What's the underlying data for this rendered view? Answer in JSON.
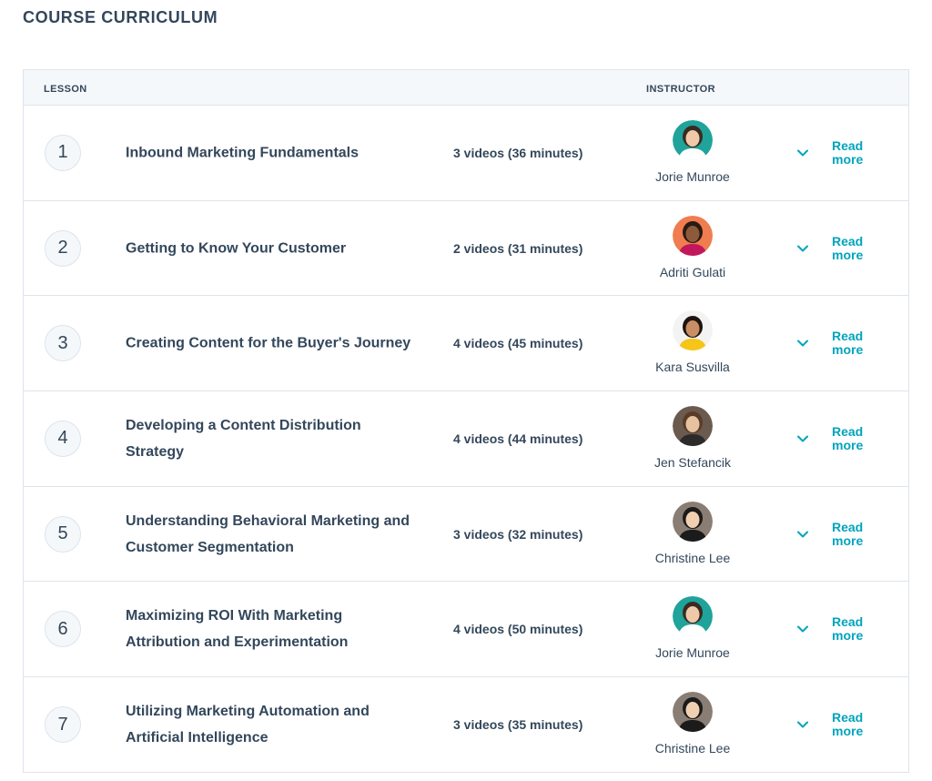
{
  "page": {
    "title": "COURSE CURRICULUM"
  },
  "table": {
    "headers": {
      "lesson": "LESSON",
      "instructor": "INSTRUCTOR"
    },
    "rows": [
      {
        "number": "1",
        "title": "Inbound Marketing Fundamentals",
        "duration": "3 videos (36 minutes)",
        "instructor": "Jorie Munroe",
        "action": "Read more"
      },
      {
        "number": "2",
        "title": "Getting to Know Your Customer",
        "duration": "2 videos (31 minutes)",
        "instructor": "Adriti Gulati",
        "action": "Read more"
      },
      {
        "number": "3",
        "title": "Creating Content for the Buyer's Journey",
        "duration": "4 videos (45 minutes)",
        "instructor": "Kara Susvilla",
        "action": "Read more"
      },
      {
        "number": "4",
        "title": "Developing a Content Distribution Strategy",
        "duration": "4 videos (44 minutes)",
        "instructor": "Jen Stefancik",
        "action": "Read more"
      },
      {
        "number": "5",
        "title": "Understanding Behavioral Marketing and Customer Segmentation",
        "duration": "3 videos (32 minutes)",
        "instructor": "Christine Lee",
        "action": "Read more"
      },
      {
        "number": "6",
        "title": "Maximizing ROI With Marketing Attribution and Experimentation",
        "duration": "4 videos (50 minutes)",
        "instructor": "Jorie Munroe",
        "action": "Read more"
      },
      {
        "number": "7",
        "title": "Utilizing Marketing Automation and Artificial Intelligence",
        "duration": "3 videos (35 minutes)",
        "instructor": "Christine Lee",
        "action": "Read more"
      }
    ]
  },
  "icons": {
    "expand": "chevron-down-icon",
    "avatar": "avatar-icon"
  },
  "colors": {
    "text": "#33475b",
    "accent": "#00a4bd",
    "border": "#dfe3eb",
    "header_bg": "#f5f8fa",
    "avatar_bgs": [
      "#1fa39a",
      "#ef7d4f",
      "#f3f3f3",
      "#6b5a4e",
      "#8a7d73",
      "#1fa39a",
      "#8a7d73"
    ],
    "avatar_skins": [
      "#f0c9a8",
      "#8d5a3b",
      "#c98e64",
      "#e6c2a0",
      "#f1d0b2",
      "#f0c9a8",
      "#f1d0b2"
    ],
    "avatar_hair": [
      "#3a2a22",
      "#2a1a14",
      "#1c1410",
      "#5a3b2a",
      "#1b1b1b",
      "#3a2a22",
      "#1b1b1b"
    ],
    "avatar_shirts": [
      "#ffffff",
      "#c2185b",
      "#f5c518",
      "#2b2b2b",
      "#1b1b1b",
      "#ffffff",
      "#1b1b1b"
    ]
  }
}
